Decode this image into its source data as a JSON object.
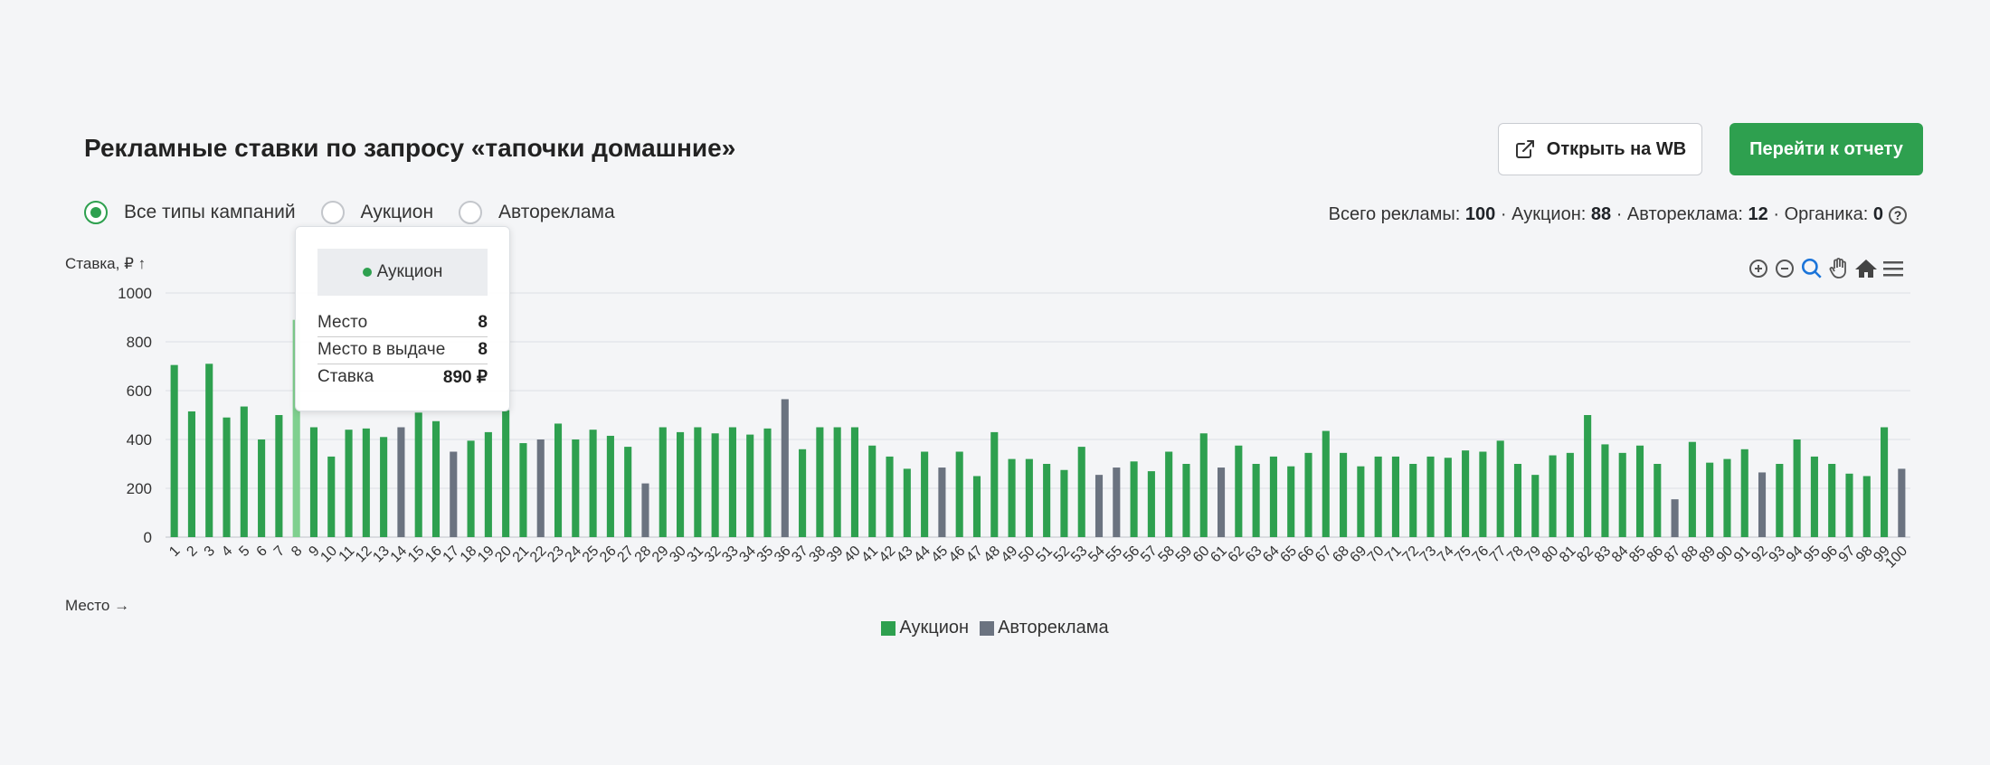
{
  "header": {
    "title": "Рекламные ставки по запросу «тапочки домашние»",
    "open_wb_label": "Открыть на WB",
    "report_label": "Перейти к отчету"
  },
  "filters": {
    "options": [
      "Все типы кампаний",
      "Аукцион",
      "Автореклама"
    ],
    "selected": "Все типы кампаний"
  },
  "summary": {
    "total_label": "Всего рекламы:",
    "total": "100",
    "auction_label": "Аукцион:",
    "auction": "88",
    "auto_label": "Автореклама:",
    "auto": "12",
    "organic_label": "Органика:",
    "organic": "0",
    "sep": "·"
  },
  "tooltip": {
    "series": "Аукцион",
    "rows": [
      {
        "label": "Место",
        "value": "8"
      },
      {
        "label": "Место в выдаче",
        "value": "8"
      },
      {
        "label": "Ставка",
        "value": "890 ₽"
      }
    ]
  },
  "toolbar_icons": [
    "zoom-in-icon",
    "zoom-out-icon",
    "zoom-select-icon",
    "pan-icon",
    "home-icon",
    "menu-icon"
  ],
  "colors": {
    "auction": "#2ea04f",
    "auction_hover": "#7fd08f",
    "auto": "#6b7380",
    "accent": "#2ea04f"
  },
  "chart_data": {
    "type": "bar",
    "ylabel": "Ставка, ₽ ↑",
    "xlabel": "Место →",
    "ylim": [
      0,
      1000
    ],
    "yticks": [
      0,
      200,
      400,
      600,
      800,
      1000
    ],
    "grid": true,
    "legend_position": "bottom-center",
    "highlighted": 8,
    "series_names": [
      "Аукцион",
      "Автореклама"
    ],
    "x": [
      1,
      2,
      3,
      4,
      5,
      6,
      7,
      8,
      9,
      10,
      11,
      12,
      13,
      14,
      15,
      16,
      17,
      18,
      19,
      20,
      21,
      22,
      23,
      24,
      25,
      26,
      27,
      28,
      29,
      30,
      31,
      32,
      33,
      34,
      35,
      36,
      37,
      38,
      39,
      40,
      41,
      42,
      43,
      44,
      45,
      46,
      47,
      48,
      49,
      50,
      51,
      52,
      53,
      54,
      55,
      56,
      57,
      58,
      59,
      60,
      61,
      62,
      63,
      64,
      65,
      66,
      67,
      68,
      69,
      70,
      71,
      72,
      73,
      74,
      75,
      76,
      77,
      78,
      79,
      80,
      81,
      82,
      83,
      84,
      85,
      86,
      87,
      88,
      89,
      90,
      91,
      92,
      93,
      94,
      95,
      96,
      97,
      98,
      99,
      100
    ],
    "values": [
      705,
      515,
      710,
      490,
      535,
      400,
      500,
      890,
      450,
      330,
      440,
      445,
      410,
      450,
      510,
      475,
      350,
      395,
      430,
      520,
      385,
      400,
      465,
      400,
      440,
      415,
      370,
      220,
      450,
      430,
      450,
      425,
      450,
      420,
      445,
      565,
      360,
      450,
      450,
      450,
      375,
      330,
      280,
      350,
      285,
      350,
      250,
      430,
      320,
      320,
      300,
      275,
      370,
      255,
      285,
      310,
      270,
      350,
      300,
      425,
      285,
      375,
      300,
      330,
      290,
      345,
      435,
      345,
      290,
      330,
      330,
      300,
      330,
      325,
      355,
      350,
      395,
      300,
      255,
      335,
      345,
      500,
      380,
      345,
      375,
      300,
      155,
      390,
      305,
      320,
      360,
      265,
      300,
      400,
      330,
      300,
      260,
      250,
      450,
      280
    ],
    "types": [
      "Аукцион",
      "Аукцион",
      "Аукцион",
      "Аукцион",
      "Аукцион",
      "Аукцион",
      "Аукцион",
      "Аукцион",
      "Аукцион",
      "Аукцион",
      "Аукцион",
      "Аукцион",
      "Аукцион",
      "Автореклама",
      "Аукцион",
      "Аукцион",
      "Автореклама",
      "Аукцион",
      "Аукцион",
      "Аукцион",
      "Аукцион",
      "Автореклама",
      "Аукцион",
      "Аукцион",
      "Аукцион",
      "Аукцион",
      "Аукцион",
      "Автореклама",
      "Аукцион",
      "Аукцион",
      "Аукцион",
      "Аукцион",
      "Аукцион",
      "Аукцион",
      "Аукцион",
      "Автореклама",
      "Аукцион",
      "Аукцион",
      "Аукцион",
      "Аукцион",
      "Аукцион",
      "Аукцион",
      "Аукцион",
      "Аукцион",
      "Автореклама",
      "Аукцион",
      "Аукцион",
      "Аукцион",
      "Аукцион",
      "Аукцион",
      "Аукцион",
      "Аукцион",
      "Аукцион",
      "Автореклама",
      "Автореклама",
      "Аукцион",
      "Аукцион",
      "Аукцион",
      "Аукцион",
      "Аукцион",
      "Автореклама",
      "Аукцион",
      "Аукцион",
      "Аукцион",
      "Аукцион",
      "Аукцион",
      "Аукцион",
      "Аукцион",
      "Аукцион",
      "Аукцион",
      "Аукцион",
      "Аукцион",
      "Аукцион",
      "Аукцион",
      "Аукцион",
      "Аукцион",
      "Аукцион",
      "Аукцион",
      "Аукцион",
      "Аукцион",
      "Аукцион",
      "Аукцион",
      "Аукцион",
      "Аукцион",
      "Аукцион",
      "Аукцион",
      "Автореклама",
      "Аукцион",
      "Аукцион",
      "Аукцион",
      "Аукцион",
      "Автореклама",
      "Аукцион",
      "Аукцион",
      "Аукцион",
      "Аукцион",
      "Аукцион",
      "Аукцион",
      "Аукцион",
      "Автореклама"
    ]
  }
}
